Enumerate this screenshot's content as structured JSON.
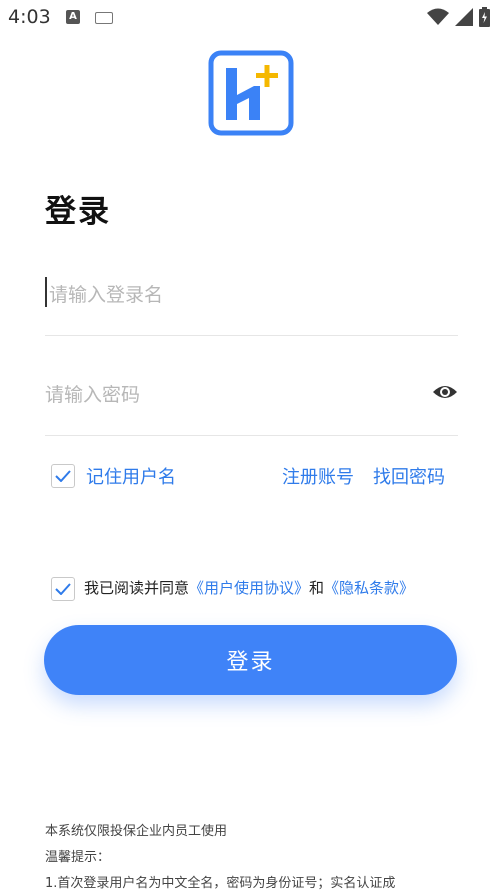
{
  "status_bar": {
    "time": "4:03",
    "icons": [
      "notification-a-icon",
      "keyboard-icon",
      "wifi-icon",
      "signal-icon",
      "battery-icon"
    ]
  },
  "logo": {
    "icon": "app-logo-h-plus",
    "colors": {
      "blue": "#3b82f6",
      "yellow": "#f5b800"
    }
  },
  "title": "登录",
  "form": {
    "username_placeholder": "请输入登录名",
    "username_value": "",
    "password_placeholder": "请输入密码",
    "password_value": ""
  },
  "remember": {
    "label": "记住用户名",
    "checked": true
  },
  "links": {
    "register": "注册账号",
    "recover": "找回密码"
  },
  "agreement": {
    "checked": true,
    "prefix": "我已阅读并同意",
    "user_agreement": "《用户使用协议》",
    "conjunction": "和",
    "privacy": "《隐私条款》"
  },
  "login_button": "登录",
  "notice": {
    "line1": "本系统仅限投保企业内员工使用",
    "line2": "温馨提示：",
    "line3": "1.首次登录用户名为中文全名，密码为身份证号；实名认证成"
  },
  "theme": {
    "accent": "#3f83f8",
    "link": "#2f7bea"
  }
}
